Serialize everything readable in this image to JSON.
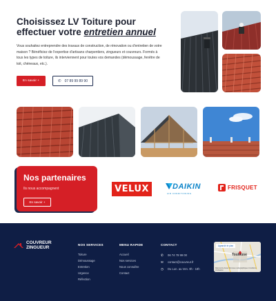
{
  "hero": {
    "title_line1": "Choisissez LV Toiture pour",
    "title_line2_prefix": "effectuer votre ",
    "title_emphasis": "entretien annuel",
    "description": "Vous souhaitez entreprendre des travaux de construction, de rénovation ou d'entretien de votre maison ? Bénéficiez de l'expertise d'artisans charpentiers, zingueurs et couvreurs. Formés à tous les types de toiture, ils interviennent pour toutes vos demandes (démoussage, fenêtre de toit, chéneaux, etc.).",
    "cta_label": "En savoir +",
    "phone_icon": "phone-icon",
    "phone": "07 89 99 89 90"
  },
  "partners": {
    "title": "Nos partenaires",
    "subtitle": "Ils nous accompagnent",
    "cta_label": "En savoir +",
    "logos": [
      {
        "name": "VELUX"
      },
      {
        "name": "DAIKIN",
        "tagline": "AIR CONDITIONING"
      },
      {
        "name": "FRISQUET"
      }
    ]
  },
  "footer": {
    "brand_line1": "COUVREUR",
    "brand_line2": "ZINGUEUR",
    "services": {
      "title": "NOS SERVICES",
      "items": [
        "Toiture",
        "Démoussage",
        "Entretien",
        "Urgence",
        "Réfection"
      ]
    },
    "quick_menu": {
      "title": "MENU RAPIDE",
      "items": [
        "Accueil",
        "Nos services",
        "Nous connaître",
        "Contact"
      ]
    },
    "contact": {
      "title": "CONTACT",
      "phone": "06 74 78 99 00",
      "email": "contact@couvreur.fr",
      "hours": "Du Lun. au Ven. 9h - 18h"
    },
    "map": {
      "button_label": "Agrandir le plan",
      "city": "Toulouse",
      "attribution": "Raccourcis clavier  Données cartographiques  Conditions d'utilisation"
    }
  },
  "colors": {
    "brand_red": "#d51f26",
    "navy": "#0f1e45"
  }
}
